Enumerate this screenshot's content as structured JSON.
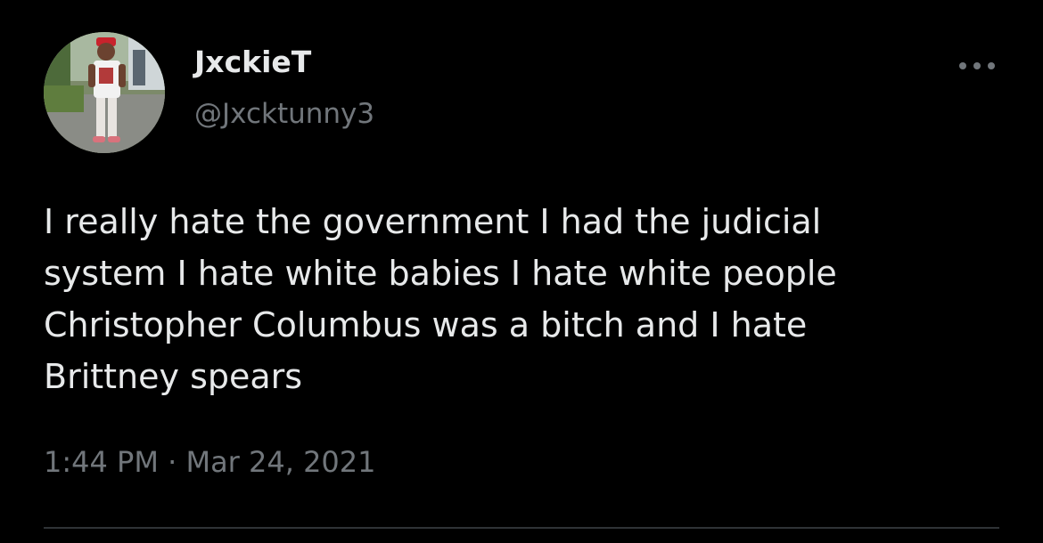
{
  "user": {
    "display_name": "JxckieT",
    "handle": "@Jxcktunny3"
  },
  "icons": {
    "avatar": "profile-photo",
    "more": "more-horizontal-icon"
  },
  "tweet": {
    "lines": [
      "I really hate the government I had the judicial",
      "system I hate white babies I hate white people",
      "Christopher Columbus was a bitch and I hate",
      "Brittney spears"
    ]
  },
  "meta": {
    "time": "1:44 PM",
    "separator": "·",
    "date": "Mar 24, 2021"
  },
  "colors": {
    "background": "#000000",
    "primary_text": "#e7e9ea",
    "secondary_text": "#71767b",
    "divider": "#2f3336"
  }
}
